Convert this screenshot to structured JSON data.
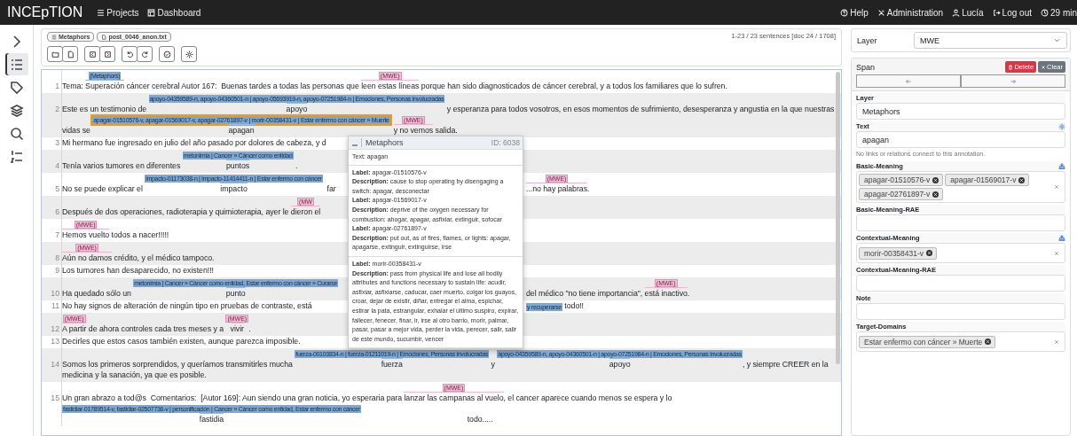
{
  "navbar": {
    "brand": "INCEpTION",
    "links": [
      {
        "kind": "projects",
        "label": "Projects"
      },
      {
        "kind": "dashboard",
        "label": "Dashboard"
      }
    ],
    "user_links": [
      {
        "kind": "help",
        "label": "Help"
      },
      {
        "kind": "admin",
        "label": "Administration"
      },
      {
        "kind": "user",
        "label": "Lucía"
      },
      {
        "kind": "logout",
        "label": "Log out"
      },
      {
        "kind": "timer",
        "label": "29 min"
      }
    ]
  },
  "sidebar": {
    "items": [
      {
        "kind": "collapse",
        "selected": false
      },
      {
        "kind": "list",
        "selected": true
      },
      {
        "kind": "tags",
        "selected": false
      },
      {
        "kind": "layers",
        "selected": false
      },
      {
        "kind": "search",
        "selected": false
      },
      {
        "kind": "numbered",
        "selected": false
      }
    ]
  },
  "toolbar": {
    "breadcrumbs": [
      {
        "kind": "project",
        "label": "Metaphors"
      },
      {
        "kind": "document",
        "label": "post_0046_anon.txt"
      }
    ],
    "status": "1-23 / 23 sentences [doc 24 / 1708]",
    "button_groups": [
      [
        {
          "kind": "open"
        },
        {
          "kind": "save"
        }
      ],
      [
        {
          "kind": "previous"
        },
        {
          "kind": "next"
        }
      ],
      [
        {
          "kind": "undo"
        },
        {
          "kind": "redo"
        }
      ],
      [
        {
          "kind": "check"
        }
      ],
      [
        {
          "kind": "settings"
        }
      ]
    ]
  },
  "document": {
    "rows": [
      {
        "number": "1",
        "lines": [
          [
            {
              "kind": "plain",
              "text": "Tema: "
            },
            {
              "kind": "metaphor",
              "label": "(Metaphors)",
              "text": "Superación",
              "selected": false
            },
            {
              "kind": "plain",
              "text": " cáncer cerebral Autor 167:  Buenas tardes a todas las personas que "
            },
            {
              "kind": "mwe",
              "label": "(MWE)",
              "text": "leen estas líneas",
              "selected": false
            },
            {
              "kind": "plain",
              "text": " porque han sido diagnosticados de cáncer cerebral, y a todos los familiares que lo sufren."
            }
          ]
        ]
      },
      {
        "number": "2",
        "lines": [
          [
            {
              "kind": "plain",
              "text": "Este es un testimonio de "
            },
            {
              "kind": "metaphor",
              "label": "apoyo-04359589-n, apoyo-04360501-n | apoyo-05693919-n, apoyo-07251984-n | Emociones, Personas involucradas",
              "text": "apoyo",
              "selected": false
            },
            {
              "kind": "plain",
              "text": " y esperanza para todos vosotros, en esos momentos de sufrimiento, desesperanza y angustia en la que nuestras"
            }
          ],
          [
            {
              "kind": "plain",
              "text": "vidas se "
            },
            {
              "kind": "metaphor",
              "label": "apagar-01510576-v, apagar-01569017-v, apagar-02761897-v | morir-00358431-v | Estar enfermo con cáncer » Muerte",
              "text": "apagan",
              "selected": true
            },
            {
              "kind": "mwe",
              "label": "(MWE)",
              "text": "y no vemos",
              "selected": false
            },
            {
              "kind": "plain",
              "text": " salida."
            }
          ]
        ]
      },
      {
        "number": "3",
        "lines": [
          [
            {
              "kind": "plain",
              "text": "Mi hermano fue ingresado en julio del año pasado por dolores de cabeza, y d"
            }
          ]
        ]
      },
      {
        "number": "4",
        "lines": [
          [
            {
              "kind": "plain",
              "text": "Tenía varios tumores en diferentes "
            },
            {
              "kind": "metaphor",
              "label": "metonimia | Cancer » Cáncer como entidad",
              "text": "puntos",
              "selected": false
            },
            {
              "kind": "plain",
              "text": " ."
            }
          ]
        ]
      },
      {
        "number": "5",
        "lines": [
          [
            {
              "kind": "plain",
              "text": "No se puede explicar el "
            },
            {
              "kind": "metaphor",
              "label": "impacto-01173038-n | impacto-11414411-n | Estar enfermo con cáncer",
              "text": "impacto",
              "selected": false
            },
            {
              "kind": "plain",
              "text": "  far"
            }
          ]
        ],
        "after_popup": [
          {
            "kind": "mwe",
            "label": "(MWE)",
            "text": "...no hay palabras",
            "selected": false
          },
          {
            "kind": "plain",
            "text": "."
          }
        ]
      },
      {
        "number": "6",
        "lines": [
          [
            {
              "kind": "plain",
              "text": "Después de dos operaciones, radioterapia y quimioterapia, ayer le "
            },
            {
              "kind": "mwe",
              "label": "(MW",
              "text": "dieron el",
              "selected": false
            }
          ]
        ]
      },
      {
        "number": "7",
        "lines": [
          [
            {
              "kind": "mwe",
              "label": "(MWE)",
              "text": "Hemos vuelto",
              "selected": false
            },
            {
              "kind": "plain",
              "text": " todos a nacer!!!!!"
            }
          ]
        ]
      },
      {
        "number": "8",
        "lines": [
          [
            {
              "kind": "mwe",
              "label": "(MWE)",
              "text": "Aún no damos",
              "selected": false
            },
            {
              "kind": "plain",
              "text": " crédito, y el médico tampoco."
            }
          ]
        ]
      },
      {
        "number": "9",
        "lines": [
          [
            {
              "kind": "plain",
              "text": "Los tumores han desaparecido, no existen!!!"
            }
          ]
        ]
      },
      {
        "number": "10",
        "lines": [
          [
            {
              "kind": "plain",
              "text": "Ha quedado sólo un "
            },
            {
              "kind": "metaphor",
              "label": "metonimia | Cancer » Cáncer como entidad, Estar enfermo con cáncer » Curarse",
              "text": "punto",
              "selected": false
            }
          ]
        ],
        "after_popup": [
          {
            "kind": "plain",
            "text": "del médico \"no tiene importancia\", "
          },
          {
            "kind": "mwe",
            "label": "(MWE)",
            "text": "está inactivo",
            "selected": false
          },
          {
            "kind": "plain",
            "text": "."
          }
        ]
      },
      {
        "number": "11",
        "lines": [
          [
            {
              "kind": "plain",
              "text": "No hay signos de alteración de ningún tipo en pruebas de contraste, está"
            }
          ]
        ],
        "after_popup": [
          {
            "kind": "metaphor",
            "label": "y recuperarse",
            "selected": false
          },
          {
            "kind": "plain",
            "text": " todo!!"
          }
        ]
      },
      {
        "number": "12",
        "lines": [
          [
            {
              "kind": "mwe",
              "label": "(MWE)",
              "text": "A partir",
              "selected": false
            },
            {
              "kind": "plain",
              "text": " de ahora controles cada tres meses y a "
            },
            {
              "kind": "mwe",
              "label": "(MWE)",
              "text": "vivir",
              "selected": false
            },
            {
              "kind": "plain",
              "text": "."
            }
          ]
        ]
      },
      {
        "number": "13",
        "lines": [
          [
            {
              "kind": "plain",
              "text": "Decirles que estos casos también existen, aunque parezca imposible."
            }
          ]
        ]
      },
      {
        "number": "14",
        "lines": [
          [
            {
              "kind": "plain",
              "text": "Somos los primeros sorprendidos, y queríamos transmitirles mucha "
            },
            {
              "kind": "metaphor",
              "label": "fuerza-00103834-n | fuerza-01211019-n | Emociones, Personas involucradas",
              "text": "fuerza",
              "selected": false
            },
            {
              "kind": "plain",
              "text": " y "
            },
            {
              "kind": "metaphor",
              "label": "apoyo-04359589-n, apoyo-04360501-n | apoyo-07251984-n | Emociones, Personas involucradas",
              "text": "apoyo",
              "selected": false
            },
            {
              "kind": "plain",
              "text": ", y siempre CREER en la"
            }
          ],
          [
            {
              "kind": "plain",
              "text": "medicina y la sanación, ya que es posible."
            }
          ]
        ]
      },
      {
        "number": "15",
        "lines": [
          [
            {
              "kind": "plain",
              "text": "Un gran abrazo a tod@s  Comentarios:  [Autor 169]: Aun siendo una gran noticia, yo esperaria para "
            },
            {
              "kind": "mwe",
              "label": "(MWE)",
              "text": "lanzar las campanas al vuelo",
              "selected": false
            },
            {
              "kind": "plain",
              "text": ", el cancer aparece cuando menos se espera y lo"
            }
          ],
          [
            {
              "kind": "metaphor",
              "label": "fastidiar-01789514-v, fastidiar-02507736-v | personificación | Cancer » Cáncer como entidad, Estar enfermo con cáncer",
              "text": "fastidia",
              "selected": false
            },
            {
              "kind": "plain",
              "text": "                                                  todo....."
            }
          ]
        ]
      }
    ],
    "popup": {
      "title": "Metaphors",
      "id": "ID: 6038",
      "text": "Text: apagan",
      "groups": [
        {
          "entries": [
            {
              "label": "**Label:** apagar-01510576-v",
              "description": "**Description:** cause to stop operating by disengaging a switch: apagar, desconectar"
            },
            {
              "label": "**Label:** apagar-01569017-v",
              "description": "**Description:** deprive of the oxygen necessary for combustion: ahogar, apagar, asfixiar, extinguir, sofocar"
            },
            {
              "label": "**Label:** apagar-02761897-v",
              "description": "**Description:** put out, as of fires, flames, or lights: apagar, apagarse, extinguir, extinguirse, irse"
            }
          ]
        },
        {
          "entries": [
            {
              "label": "**Label:** morir-00358431-v",
              "description": "**Description:** pass from physical life and lose all bodily attributes and functions necessary to sustain life: acudir, asfixiar, asfixiarse, caducar, caer muerto, colgar los guayos, croar, dejar de existir, diñar, entregar el alma, espichar, estirar la pata, estrangular, exhalar el último suspiro, expirar, fallecer, fenecer, finar, ir, irse al otro barrio, morir, palmar, pasar, pasar a mejor vida, perder la vida, perecer, salir, salir de este mundo, sucumbir, vencer"
            }
          ]
        }
      ]
    }
  },
  "right_panel": {
    "layer": {
      "label": "Layer",
      "value": "MWE"
    },
    "span": {
      "title": "Span",
      "delete": "Delete",
      "clear": "Clear",
      "fields": [
        {
          "kind": "text",
          "label": "Layer",
          "value": "Metaphors"
        },
        {
          "kind": "linked_text",
          "label": "Text",
          "value": "apagan"
        },
        {
          "kind": "note",
          "text": "No links or relations connect to this annotation."
        },
        {
          "kind": "tags",
          "label": "Basic-Meaning",
          "lookup": true,
          "tags": [
            "apagar-01510576-v",
            "apagar-01569017-v",
            "apagar-02761897-v"
          ]
        },
        {
          "kind": "text",
          "label": "Basic-Meaning-RAE"
        },
        {
          "kind": "tags",
          "label": "Contextual-Meaning",
          "lookup": true,
          "tags": [
            "morir-00358431-v"
          ]
        },
        {
          "kind": "text",
          "label": "Contextual-Meaning-RAE"
        },
        {
          "kind": "text",
          "label": "Note"
        },
        {
          "kind": "tags",
          "label": "Target-Domains",
          "lookup": false,
          "tags": [
            "Estar enfermo con cáncer » Muerte"
          ]
        }
      ]
    }
  }
}
